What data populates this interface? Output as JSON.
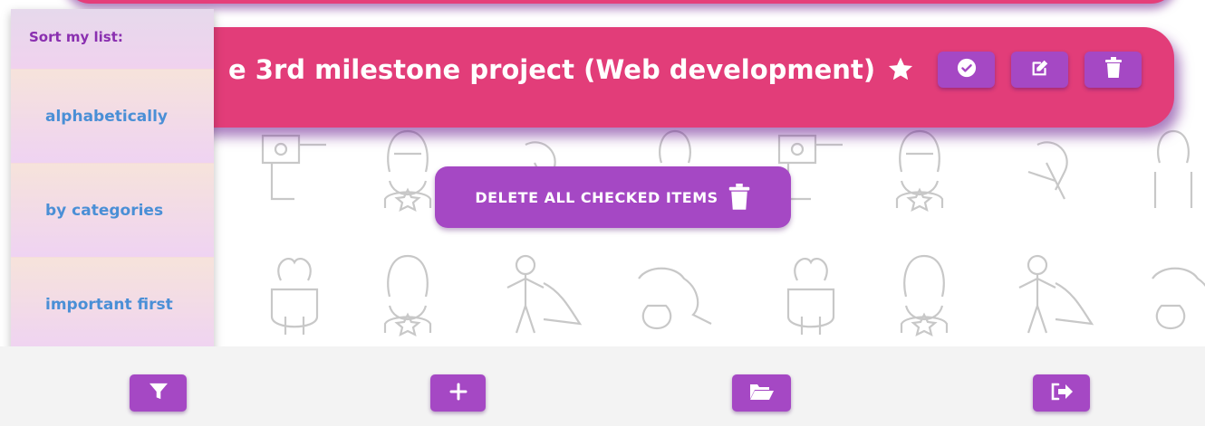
{
  "item": {
    "title": "e 3rd milestone project (Web development)",
    "icons": [
      "star-icon"
    ],
    "actions": [
      {
        "name": "check-button",
        "icon": "check-circle-icon"
      },
      {
        "name": "edit-button",
        "icon": "edit-icon"
      },
      {
        "name": "delete-button",
        "icon": "trash-icon"
      }
    ]
  },
  "delete_all": {
    "label": "DELETE ALL CHECKED ITEMS",
    "icon": "trash-icon"
  },
  "sort_menu": {
    "header": "Sort my list:",
    "options": [
      "alphabetically",
      "by categories",
      "important first"
    ]
  },
  "footer": {
    "buttons": [
      {
        "name": "filter-button",
        "icon": "filter-icon"
      },
      {
        "name": "add-button",
        "icon": "plus-icon"
      },
      {
        "name": "open-folder-button",
        "icon": "folder-open-icon"
      },
      {
        "name": "logout-button",
        "icon": "sign-out-icon"
      }
    ]
  },
  "colors": {
    "card": "#e23d79",
    "button": "#a548c4",
    "menu_text": "#4a8fd6",
    "menu_header": "#8a2fb0",
    "footer_bg": "#f3f3f3"
  }
}
